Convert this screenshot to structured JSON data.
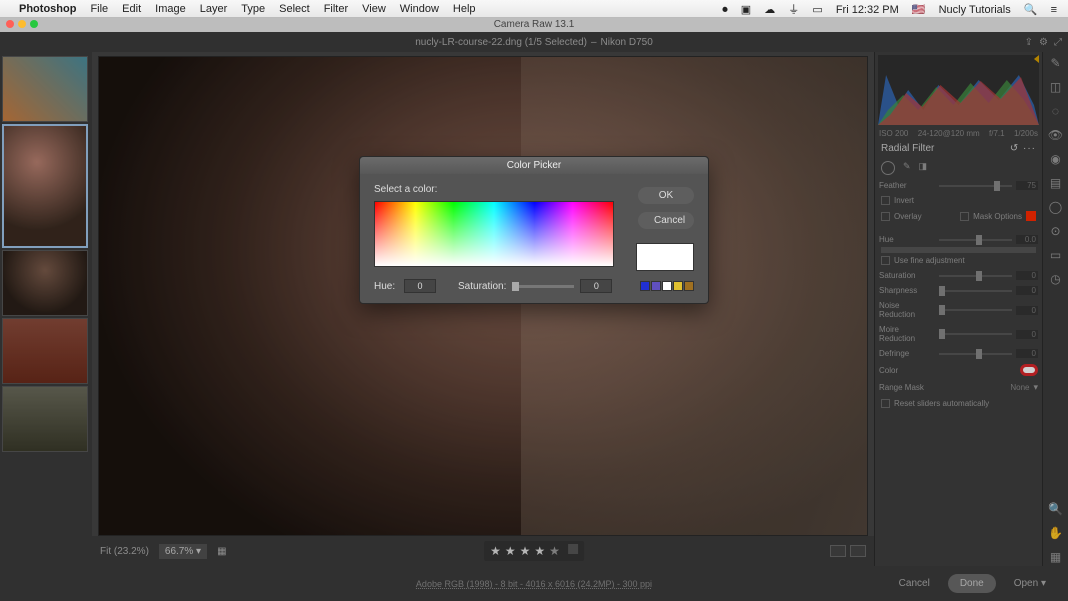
{
  "menubar": {
    "app": "Photoshop",
    "items": [
      "File",
      "Edit",
      "Image",
      "Layer",
      "Type",
      "Select",
      "Filter",
      "View",
      "Window",
      "Help"
    ],
    "time": "Fri 12:32 PM",
    "user": "Nucly Tutorials"
  },
  "titlebar": {
    "title": "Camera Raw 13.1"
  },
  "cr_header": {
    "filename": "nucly-LR-course-22.dng  (1/5 Selected)",
    "camera": "Nikon D750"
  },
  "histogram": {
    "iso": "ISO 200",
    "lens": "24-120@120 mm",
    "aperture": "f/7.1",
    "shutter": "1/200s"
  },
  "panel": {
    "title": "Radial Filter",
    "feather": {
      "label": "Feather",
      "value": "75"
    },
    "invert": "Invert",
    "overlay": "Overlay",
    "mask_options": "Mask Options",
    "hue": {
      "label": "Hue",
      "value": "0.0"
    },
    "use_fine": "Use fine adjustment",
    "saturation": {
      "label": "Saturation",
      "value": "0"
    },
    "sharpness": {
      "label": "Sharpness",
      "value": "0"
    },
    "noise": {
      "label": "Noise Reduction",
      "value": "0"
    },
    "moire": {
      "label": "Moire Reduction",
      "value": "0"
    },
    "defringe": {
      "label": "Defringe",
      "value": "0"
    },
    "color": "Color",
    "range_mask": {
      "label": "Range Mask",
      "value": "None"
    },
    "reset": "Reset sliders automatically"
  },
  "status": {
    "fit": "Fit (23.2%)",
    "zoom": "66.7%"
  },
  "stars": 4,
  "footer": {
    "meta": "Adobe RGB (1998) - 8 bit - 4016 x 6016 (24.2MP) - 300 ppi",
    "cancel": "Cancel",
    "done": "Done",
    "open": "Open"
  },
  "dialog": {
    "title": "Color Picker",
    "prompt": "Select a color:",
    "ok": "OK",
    "cancel": "Cancel",
    "hue": {
      "label": "Hue:",
      "value": "0"
    },
    "saturation": {
      "label": "Saturation:",
      "value": "0"
    },
    "swatches": [
      "#2030d0",
      "#6050c0",
      "#ffffff",
      "#e0c030",
      "#a07020"
    ]
  }
}
